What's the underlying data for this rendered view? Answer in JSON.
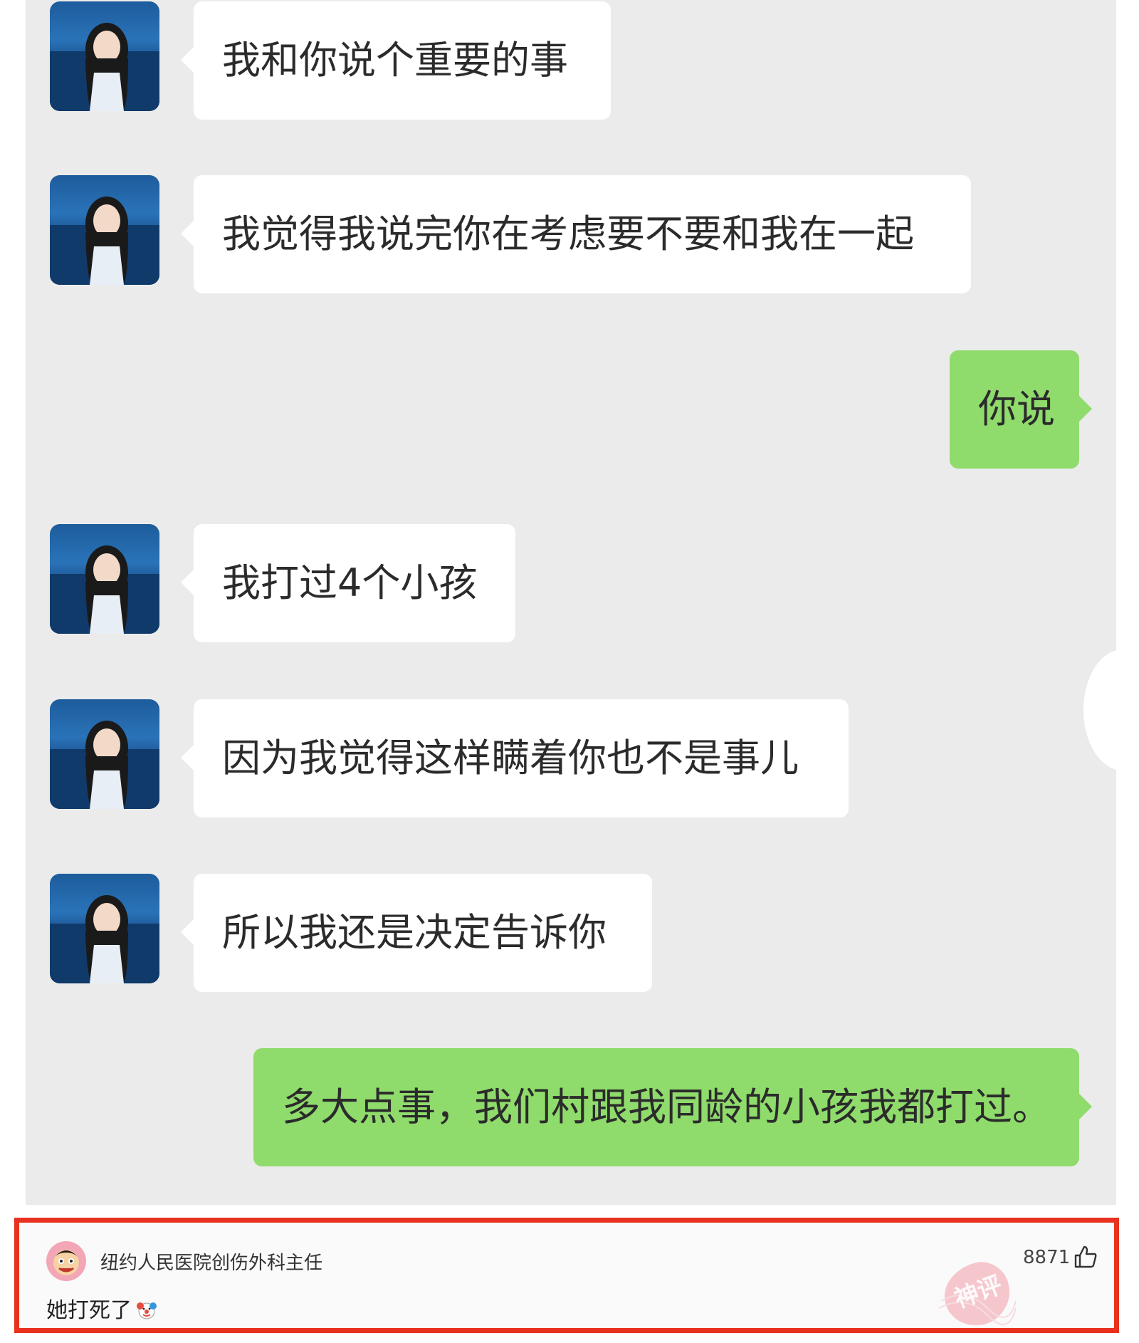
{
  "messages": [
    {
      "side": "in",
      "text": "我和你说个重要的事"
    },
    {
      "side": "in",
      "text": "我觉得我说完你在考虑要不要和我在一起"
    },
    {
      "side": "out",
      "text": "你说"
    },
    {
      "side": "in",
      "text": "我打过4个小孩"
    },
    {
      "side": "in",
      "text": "因为我觉得这样瞒着你也不是事儿"
    },
    {
      "side": "in",
      "text": "所以我还是决定告诉你"
    },
    {
      "side": "out",
      "text": "多大点事，我们村跟我同龄的小孩我都打过。"
    }
  ],
  "comment": {
    "username": "纽约人民医院创伤外科主任",
    "text": "她打死了",
    "emoji_icon": "clown-face-icon",
    "likes": "8871",
    "like_icon": "thumbs-up-icon",
    "stamp_text": "神评"
  },
  "colors": {
    "chat_background": "#ebebeb",
    "incoming_bubble": "#ffffff",
    "outgoing_bubble": "#8fdb6c",
    "highlight_border": "#e8321f"
  }
}
